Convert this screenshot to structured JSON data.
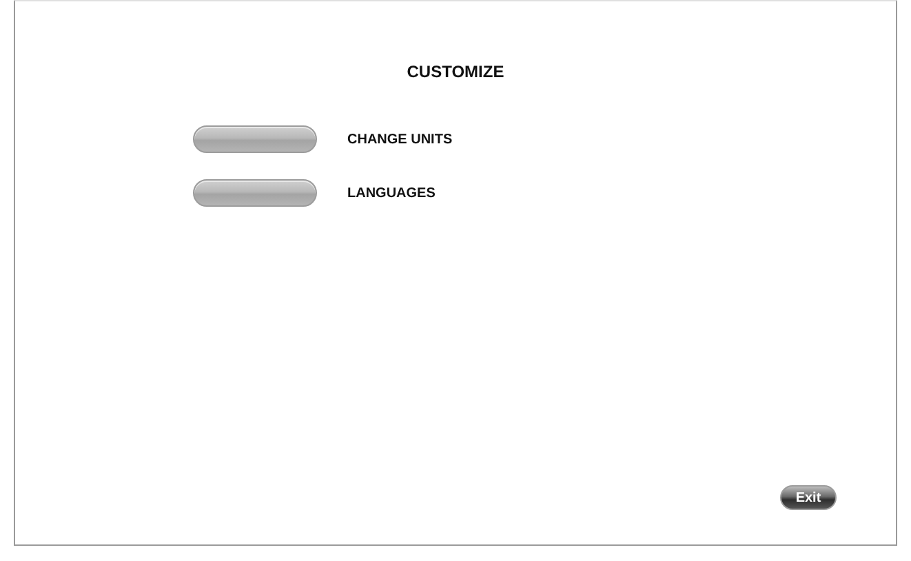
{
  "title": "CUSTOMIZE",
  "options": [
    {
      "label": "CHANGE UNITS"
    },
    {
      "label": "LANGUAGES"
    }
  ],
  "exit_button": {
    "label": "Exit"
  }
}
